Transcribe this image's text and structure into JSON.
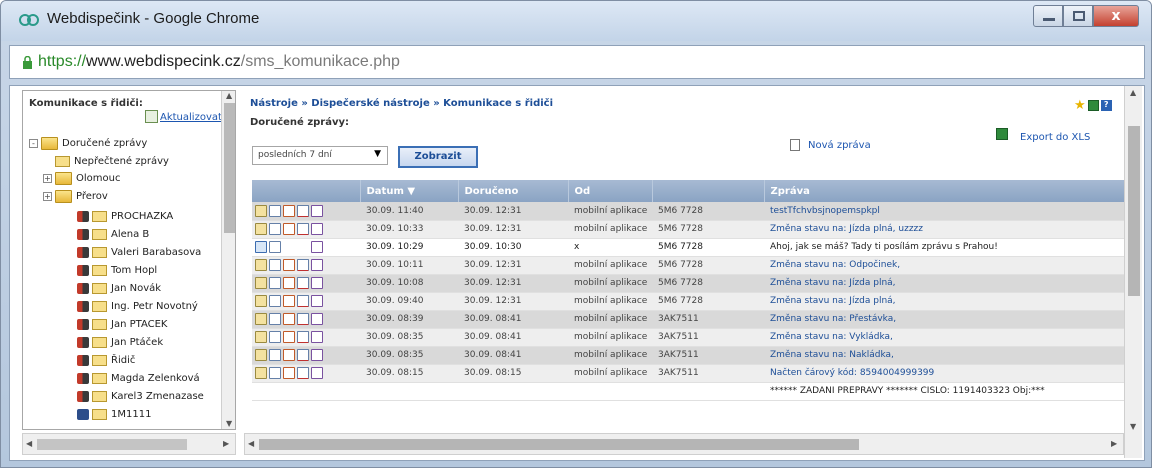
{
  "window": {
    "title": "Webdispečink - Google Chrome",
    "controls": {
      "close": "x"
    }
  },
  "address_bar": {
    "scheme": "https://",
    "host": "www.webdispecink.cz",
    "path": "/sms_komunikace.php"
  },
  "sidebar": {
    "title": "Komunikace s řidiči:",
    "refresh_label": "Aktualizovat",
    "tree": [
      {
        "label": "Doručené zprávy",
        "type": "folder",
        "toggle": "-"
      },
      {
        "label": "Nepřečtené zprávy",
        "type": "envelope"
      },
      {
        "label": "Olomouc",
        "type": "folder",
        "toggle": "+"
      },
      {
        "label": "Přerov",
        "type": "folder",
        "toggle": "+"
      },
      {
        "label": "PROCHAZKA",
        "type": "driver"
      },
      {
        "label": "Alena B",
        "type": "driver"
      },
      {
        "label": "Valeri Barabasova",
        "type": "driver"
      },
      {
        "label": "Tom Hopl",
        "type": "driver"
      },
      {
        "label": "Jan Novák",
        "type": "driver"
      },
      {
        "label": "Ing. Petr Novotný",
        "type": "driver"
      },
      {
        "label": "Jan PTACEK",
        "type": "driver"
      },
      {
        "label": "Jan Ptáček",
        "type": "driver"
      },
      {
        "label": "Řidič",
        "type": "driver"
      },
      {
        "label": "Magda Zelenková",
        "type": "driver"
      },
      {
        "label": "Karel3 Zmenazase",
        "type": "driver"
      },
      {
        "label": "1M1111",
        "type": "vehicle"
      }
    ]
  },
  "main": {
    "breadcrumb": "Nástroje » Dispečerské nástroje » Komunikace s řidiči",
    "section_label": "Doručené zprávy:",
    "filter": {
      "selected": "posledních 7 dní"
    },
    "show_button": "Zobrazit",
    "new_message": "Nová zpráva",
    "export": "Export do XLS",
    "table": {
      "columns": [
        "",
        "Datum",
        "Doručeno",
        "Od",
        "",
        "Zpráva"
      ],
      "rows": [
        {
          "date": "30.09. 11:40",
          "delivered": "30.09. 12:31",
          "from": "mobilní aplikace",
          "vehicle": "5M6 7728",
          "message": "testTfchvbsjnopemspkpl",
          "unread": false
        },
        {
          "date": "30.09. 10:33",
          "delivered": "30.09. 12:31",
          "from": "mobilní aplikace",
          "vehicle": "5M6 7728",
          "message": "Změna stavu na: Jízda plná, uzzzz",
          "unread": false
        },
        {
          "date": "30.09. 10:29",
          "delivered": "30.09. 10:30",
          "from": "x",
          "vehicle": "5M6 7728",
          "message": "Ahoj, jak se máš? Tady ti posílám zprávu s Prahou!",
          "unread": true
        },
        {
          "date": "30.09. 10:11",
          "delivered": "30.09. 12:31",
          "from": "mobilní aplikace",
          "vehicle": "5M6 7728",
          "message": "Změna stavu na: Odpočinek,",
          "unread": false
        },
        {
          "date": "30.09. 10:08",
          "delivered": "30.09. 12:31",
          "from": "mobilní aplikace",
          "vehicle": "5M6 7728",
          "message": "Změna stavu na: Jízda plná,",
          "unread": false
        },
        {
          "date": "30.09. 09:40",
          "delivered": "30.09. 12:31",
          "from": "mobilní aplikace",
          "vehicle": "5M6 7728",
          "message": "Změna stavu na: Jízda plná,",
          "unread": false
        },
        {
          "date": "30.09. 08:39",
          "delivered": "30.09. 08:41",
          "from": "mobilní aplikace",
          "vehicle": "3AK7511",
          "message": "Změna stavu na: Přestávka,",
          "unread": false
        },
        {
          "date": "30.09. 08:35",
          "delivered": "30.09. 08:41",
          "from": "mobilní aplikace",
          "vehicle": "3AK7511",
          "message": "Změna stavu na: Vykládka,",
          "unread": false
        },
        {
          "date": "30.09. 08:35",
          "delivered": "30.09. 08:41",
          "from": "mobilní aplikace",
          "vehicle": "3AK7511",
          "message": "Změna stavu na: Nakládka,",
          "unread": false
        },
        {
          "date": "30.09. 08:15",
          "delivered": "30.09. 08:15",
          "from": "mobilní aplikace",
          "vehicle": "3AK7511",
          "message": "Načten čárový kód: 8594004999399",
          "unread": false
        },
        {
          "date": "",
          "delivered": "",
          "from": "",
          "vehicle": "",
          "message": "****** ZADANI PREPRAVY ******* CISLO: 1191403323 Obj:***",
          "unread": true
        }
      ]
    }
  },
  "colors": {
    "accent": "#1d4e97",
    "header_bg": "#8aa3c3",
    "row_dark": "#d9d9d9",
    "row_light": "#eeeeee"
  }
}
